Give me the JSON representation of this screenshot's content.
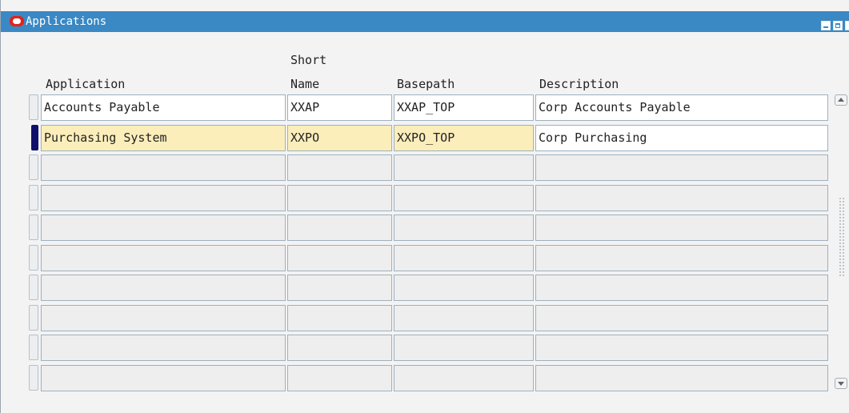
{
  "window": {
    "title": "Applications",
    "accent_color": "#3a88c4",
    "logo_color": "#e2231a"
  },
  "columns": {
    "application": "Application",
    "short_name_line1": "Short",
    "short_name_line2": "Name",
    "basepath": "Basepath",
    "description": "Description"
  },
  "rows": [
    {
      "application": "Accounts Payable",
      "short_name": "XXAP",
      "basepath": "XXAP_TOP",
      "description": "Corp Accounts Payable",
      "state": "filled"
    },
    {
      "application": "Purchasing System",
      "short_name": "XXPO",
      "basepath": "XXPO_TOP",
      "description": "Corp Purchasing",
      "state": "current"
    },
    {
      "application": "",
      "short_name": "",
      "basepath": "",
      "description": "",
      "state": "empty"
    },
    {
      "application": "",
      "short_name": "",
      "basepath": "",
      "description": "",
      "state": "empty"
    },
    {
      "application": "",
      "short_name": "",
      "basepath": "",
      "description": "",
      "state": "empty"
    },
    {
      "application": "",
      "short_name": "",
      "basepath": "",
      "description": "",
      "state": "empty"
    },
    {
      "application": "",
      "short_name": "",
      "basepath": "",
      "description": "",
      "state": "empty"
    },
    {
      "application": "",
      "short_name": "",
      "basepath": "",
      "description": "",
      "state": "empty"
    },
    {
      "application": "",
      "short_name": "",
      "basepath": "",
      "description": "",
      "state": "empty"
    },
    {
      "application": "",
      "short_name": "",
      "basepath": "",
      "description": "",
      "state": "empty"
    }
  ],
  "colors": {
    "current_row": "#fbeebb",
    "filled_row": "#ffffff",
    "empty_row": "#eeeeee",
    "record_indicator": "#10106a"
  },
  "icons": {
    "logo": "oracle-logo-icon",
    "minimize": "minimize-icon",
    "maximize": "maximize-icon",
    "close": "close-icon",
    "scroll_up": "scroll-up-icon",
    "scroll_down": "scroll-down-icon"
  }
}
